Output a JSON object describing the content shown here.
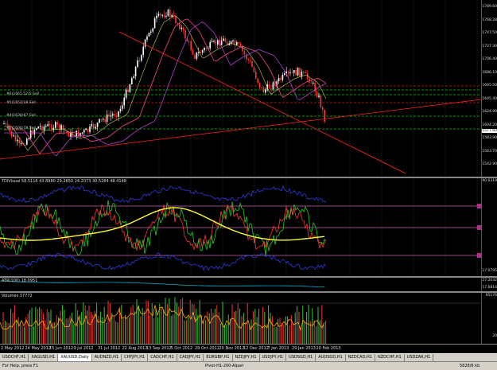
{
  "main_chart": {
    "price_ticks": [
      "1789.60",
      "1768.28",
      "1747.50",
      "1727.30",
      "1706.40",
      "1686.10",
      "1665.50",
      "1645.40",
      "1624.90",
      "1604.20",
      "1583.90",
      "1563.70",
      "1542.90"
    ],
    "current_price": "1577.60",
    "level_labels": [
      "#6(1665.52)5 Sell",
      "#5(1652)18 Sell",
      "#4(1636)67 Sell",
      "#0(1606)78 Sell"
    ],
    "colors": {
      "bull": "#ffffff",
      "bear": "#ff3333",
      "ma_pink": "#ff4488",
      "ma_purple": "#aa44cc",
      "ma_yellow": "#cccc55",
      "green_level": "#00cc00",
      "red_level": "#cc2222",
      "trend": "#ff2222"
    }
  },
  "indicators": {
    "tdi_label": "TDIVisual 58.5116 43.8980 29.2650 24.2073 30.5284 48.4148",
    "tdi_ticks": [
      "90.6319",
      "17.0795"
    ],
    "atr_label": "ATR(100) 18.0951",
    "atr_ticks": [
      "27.2032",
      "17.6814"
    ],
    "volumes_label": "Volumes 37772",
    "volume_ticks": [
      "95176",
      "20"
    ]
  },
  "x_axis": {
    "dates": [
      "2 May 2012",
      "24 May 2012",
      "15 Jun 2012",
      "9 Jul 2012",
      "31 Jul 2012",
      "22 Aug 2012",
      "13 Sep 2012",
      "5 Oct 2012",
      "29 Oct 2012",
      "20 Nov 2012",
      "12 Dec 2012",
      "7 Jan 2013",
      "29 Jan 2013",
      "20 Feb 2013"
    ]
  },
  "tabs": [
    {
      "label": "USDCHF,H1",
      "active": false
    },
    {
      "label": "XAGUSD,H1",
      "active": false
    },
    {
      "label": "XAUUSD,Daily",
      "active": true
    },
    {
      "label": "AUDNZD,H1",
      "active": false
    },
    {
      "label": "CHFJPY,H1",
      "active": false
    },
    {
      "label": "CADCHF,H1",
      "active": false
    },
    {
      "label": "CADJPY,H1",
      "active": false
    },
    {
      "label": "EURGBP,H1",
      "active": false
    },
    {
      "label": "NZDJPY,H1",
      "active": false
    },
    {
      "label": "USDJPY,H1",
      "active": false
    },
    {
      "label": "USDSGD,H1",
      "active": false
    },
    {
      "label": "AUDSGD,H1",
      "active": false
    },
    {
      "label": "NZDCAD,H1",
      "active": false
    },
    {
      "label": "NZDCHF,H1",
      "active": false
    },
    {
      "label": "USDZAR,H1",
      "active": false
    }
  ],
  "status_bar": {
    "help": "For Help, press F1",
    "profile": "Pivot-H1-200-Alpari",
    "traffic": "5828/6 kb"
  }
}
